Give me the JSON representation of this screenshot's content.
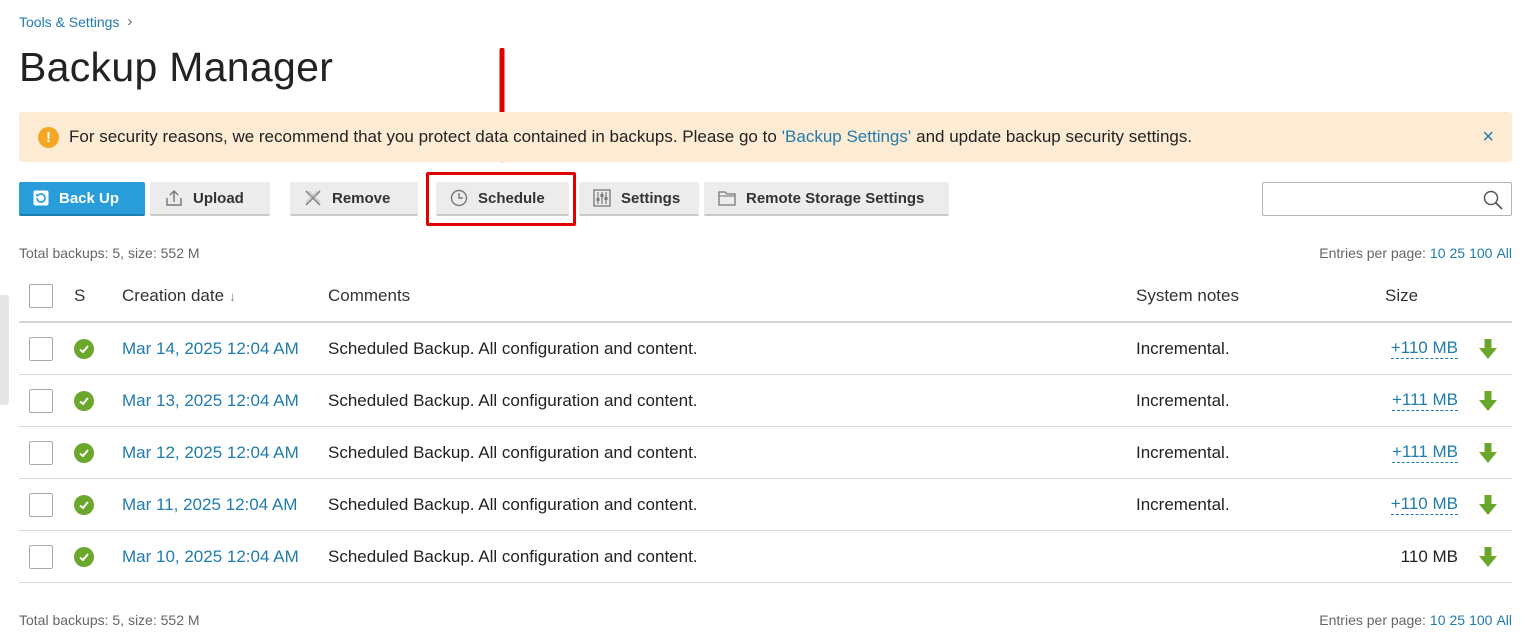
{
  "breadcrumb": {
    "label": "Tools & Settings"
  },
  "page": {
    "title": "Backup Manager"
  },
  "alert": {
    "text_before": "For security reasons, we recommend that you protect data contained in backups. Please go to",
    "link": "'Backup Settings'",
    "text_after": "and update backup security settings.",
    "close": "×"
  },
  "toolbar": {
    "backup": "Back Up",
    "upload": "Upload",
    "remove": "Remove",
    "schedule": "Schedule",
    "settings": "Settings",
    "remote": "Remote Storage Settings"
  },
  "search": {
    "value": "",
    "placeholder": ""
  },
  "summary": "Total backups: 5, size: 552 M",
  "perpage": {
    "label": "Entries per page:",
    "options": [
      "10",
      "25",
      "100",
      "All"
    ]
  },
  "table": {
    "headers": {
      "status": "S",
      "date": "Creation date",
      "sort": "↓",
      "comments": "Comments",
      "notes": "System notes",
      "size": "Size"
    },
    "rows": [
      {
        "date": "Mar 14, 2025 12:04 AM",
        "comment": "Scheduled Backup. All configuration and content.",
        "notes": "Incremental.",
        "size": "+110 MB"
      },
      {
        "date": "Mar 13, 2025 12:04 AM",
        "comment": "Scheduled Backup. All configuration and content.",
        "notes": "Incremental.",
        "size": "+111 MB"
      },
      {
        "date": "Mar 12, 2025 12:04 AM",
        "comment": "Scheduled Backup. All configuration and content.",
        "notes": "Incremental.",
        "size": "+111 MB"
      },
      {
        "date": "Mar 11, 2025 12:04 AM",
        "comment": "Scheduled Backup. All configuration and content.",
        "notes": "Incremental.",
        "size": "+110 MB"
      },
      {
        "date": "Mar 10, 2025 12:04 AM",
        "comment": "Scheduled Backup. All configuration and content.",
        "notes": "",
        "size": "110 MB"
      }
    ]
  },
  "colors": {
    "accent": "#1f7cad",
    "primary_button": "#289dd9",
    "alert_bg": "#fdecd3",
    "warning": "#f5a623",
    "success": "#6aa72c",
    "highlight": "#e10000"
  }
}
